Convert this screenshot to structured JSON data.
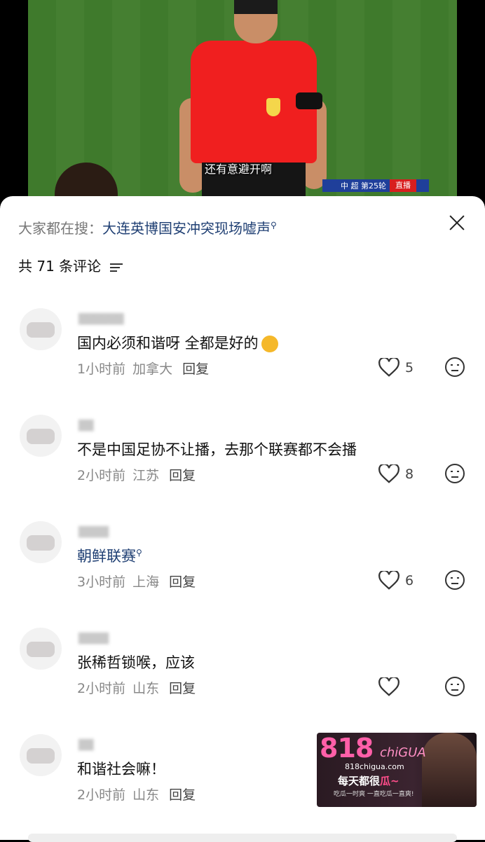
{
  "video": {
    "subtitle": "还有意避开啊",
    "scorebar": {
      "league": "中 超 第25轮",
      "live": "直播"
    }
  },
  "panel": {
    "search_prefix": "大家都在搜：",
    "search_term": "大连英博国安冲突现场嘘声",
    "comment_count": "共 71 条评论",
    "close_icon": "close-icon",
    "filter_icon": "filter-icon"
  },
  "comments": [
    {
      "text": "国内必须和谐呀 全都是好的",
      "emoji": "ok-hand-emoji",
      "time": "1小时前",
      "location": "加拿大",
      "reply": "回复",
      "likes": "5"
    },
    {
      "text": "不是中国足协不让播，去那个联赛都不会播",
      "time": "2小时前",
      "location": "江苏",
      "reply": "回复",
      "likes": "8"
    },
    {
      "text": "朝鲜联赛",
      "is_search_link": true,
      "time": "3小时前",
      "location": "上海",
      "reply": "回复",
      "likes": "6"
    },
    {
      "text": "张稀哲锁喉，应该",
      "time": "2小时前",
      "location": "山东",
      "reply": "回复",
      "likes": ""
    },
    {
      "text": "和谐社会嘛！",
      "time": "2小时前",
      "location": "山东",
      "reply": "回复",
      "likes": ""
    }
  ],
  "ad": {
    "brand": "818",
    "brand_suffix": "chiGUA",
    "domain": "818chigua.com",
    "slogan_prefix": "每天都很",
    "slogan_highlight": "瓜~",
    "tagline": "吃瓜一时爽 一直吃瓜一直爽!"
  }
}
